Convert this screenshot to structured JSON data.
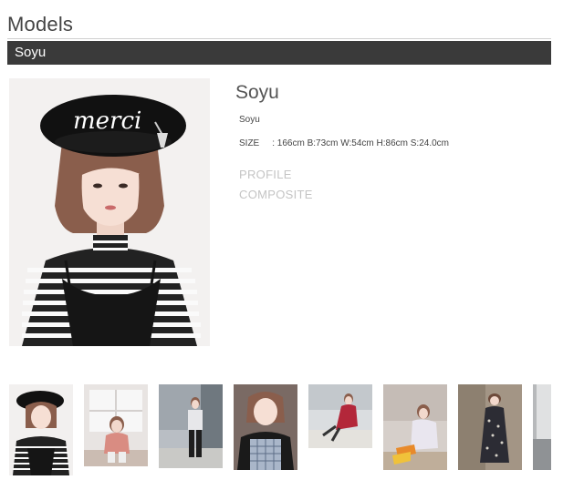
{
  "page": {
    "heading": "Models"
  },
  "model": {
    "bar_name": "Soyu",
    "name": "Soyu",
    "sub_name": "Soyu",
    "size_label": "SIZE",
    "size_value": ": 166cm B:73cm W:54cm H:86cm S:24.0cm",
    "hat_text": "merci"
  },
  "links": {
    "profile": "PROFILE",
    "composite": "COMPOSITE"
  },
  "thumbnails": [
    {
      "label": "beret striped top"
    },
    {
      "label": "sitting by window"
    },
    {
      "label": "full body street"
    },
    {
      "label": "plaid pinafore"
    },
    {
      "label": "red dress sitting"
    },
    {
      "label": "floral shirt sitting"
    },
    {
      "label": "floral dress standing"
    },
    {
      "label": "partial"
    }
  ]
}
